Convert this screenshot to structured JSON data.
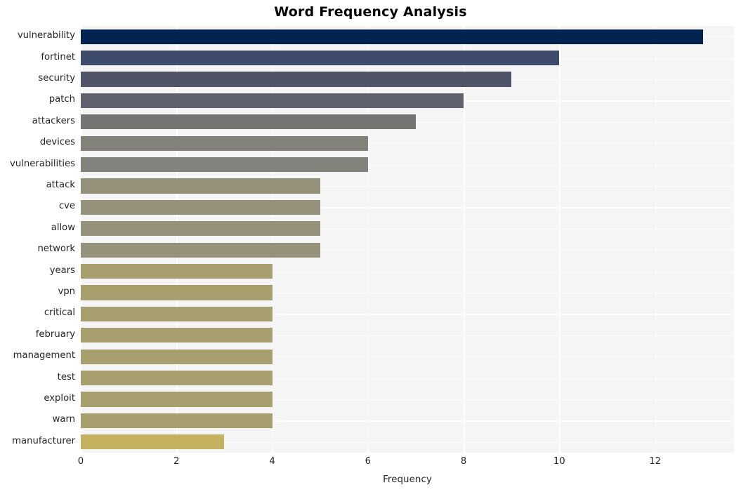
{
  "chart_data": {
    "type": "bar",
    "orientation": "horizontal",
    "title": "Word Frequency Analysis",
    "xlabel": "Frequency",
    "ylabel": "",
    "categories": [
      "vulnerability",
      "fortinet",
      "security",
      "patch",
      "attackers",
      "devices",
      "vulnerabilities",
      "attack",
      "cve",
      "allow",
      "network",
      "years",
      "vpn",
      "critical",
      "february",
      "management",
      "test",
      "exploit",
      "warn",
      "manufacturer"
    ],
    "values": [
      13,
      10,
      9,
      8,
      7,
      6,
      6,
      5,
      5,
      5,
      5,
      4,
      4,
      4,
      4,
      4,
      4,
      4,
      4,
      3
    ],
    "bar_colors": [
      "#002350",
      "#3c4a6b",
      "#4f5469",
      "#61616d",
      "#747472",
      "#82817a",
      "#83827b",
      "#95907a",
      "#96917a",
      "#96917a",
      "#96917a",
      "#a79f6d",
      "#a79f6d",
      "#a79f6d",
      "#a79f6d",
      "#a79f6d",
      "#a79f6d",
      "#a79f6d",
      "#a79f6d",
      "#c3b15f"
    ],
    "xlim": [
      0,
      13.65
    ],
    "xticks": [
      0,
      2,
      4,
      6,
      8,
      10,
      12
    ],
    "xticklabels": [
      "0",
      "2",
      "4",
      "6",
      "8",
      "10",
      "12"
    ],
    "grid": true,
    "grid_color": "#ffffff",
    "plot_background": "#f5f5f5",
    "figure_background": "#ffffff",
    "legend": null,
    "colormap": "cividis"
  }
}
